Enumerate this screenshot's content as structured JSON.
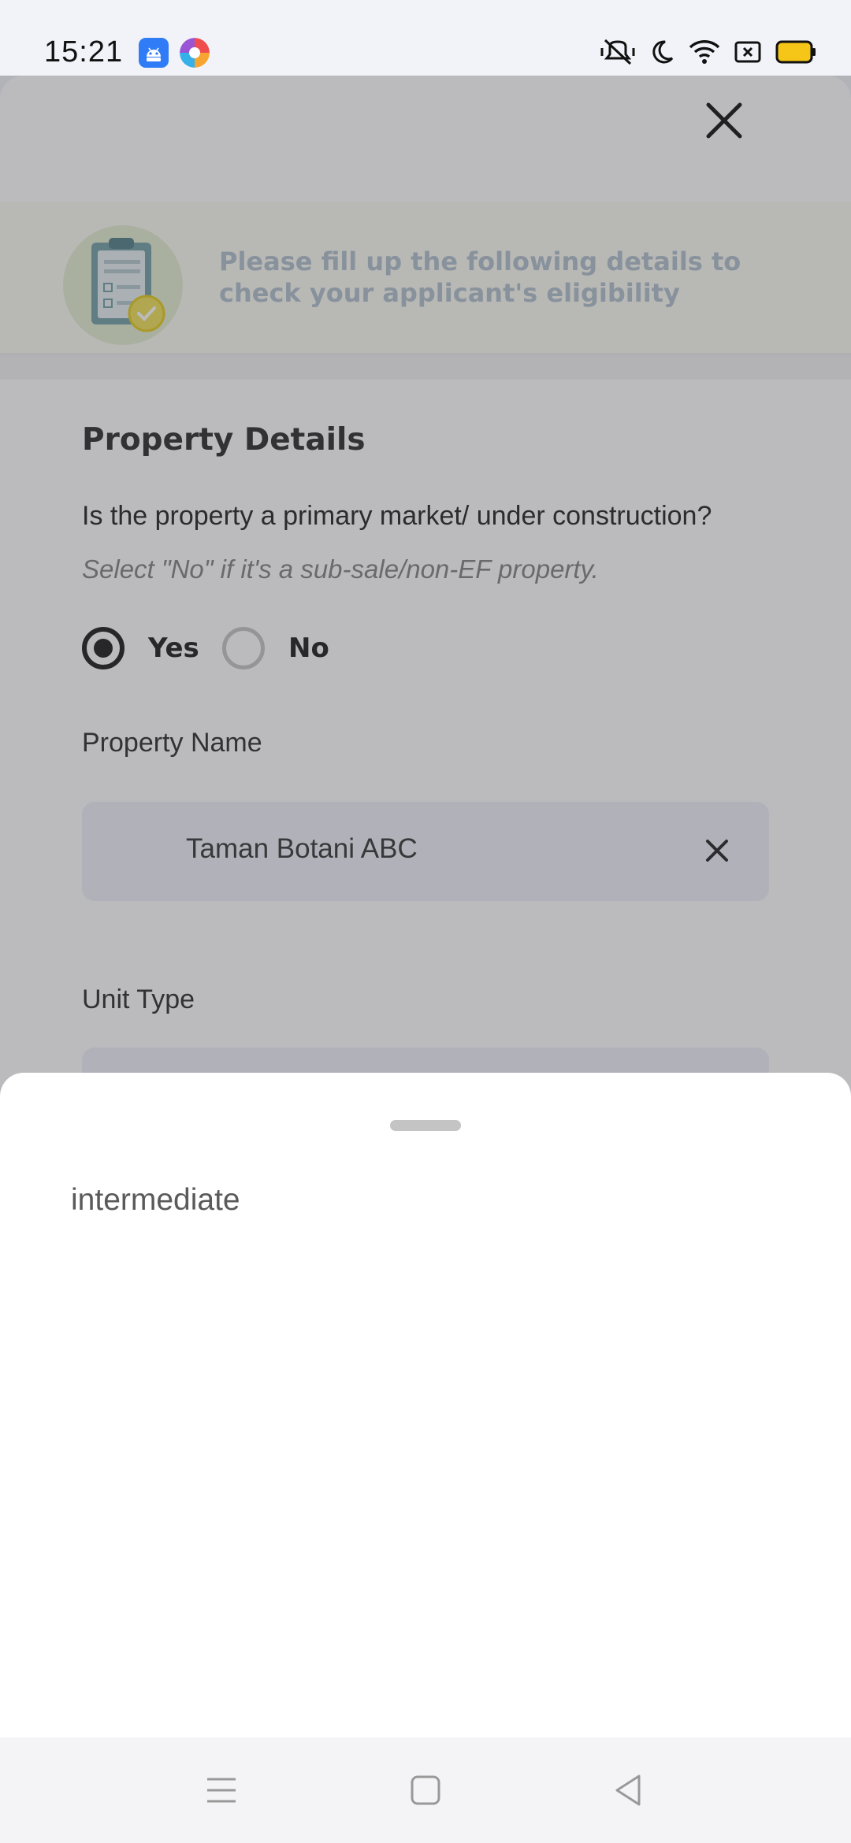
{
  "status_bar": {
    "time": "15:21",
    "left_icons": [
      "android-app-icon",
      "browser-app-icon"
    ],
    "right_icons": [
      "vibrate-off-icon",
      "moon-icon",
      "wifi-icon",
      "sim-icon",
      "battery-icon"
    ],
    "battery_color": "#f5c518"
  },
  "banner": {
    "text": "Please fill up the following details to check your applicant's eligibility",
    "icon": "clipboard-check-icon"
  },
  "form": {
    "section_title": "Property Details",
    "question": "Is the property a primary market/ under construction?",
    "hint": "Select \"No\" if it's a sub-sale/non-EF property.",
    "radio_yes_label": "Yes",
    "radio_no_label": "No",
    "selected": "Yes",
    "property_name_label": "Property Name",
    "property_name_value": "Taman Botani ABC",
    "unit_type_label": "Unit Type"
  },
  "bottom_sheet": {
    "options": [
      "intermediate"
    ]
  },
  "nav_bar": {
    "buttons": [
      "menu-icon",
      "home-icon",
      "back-icon"
    ]
  }
}
